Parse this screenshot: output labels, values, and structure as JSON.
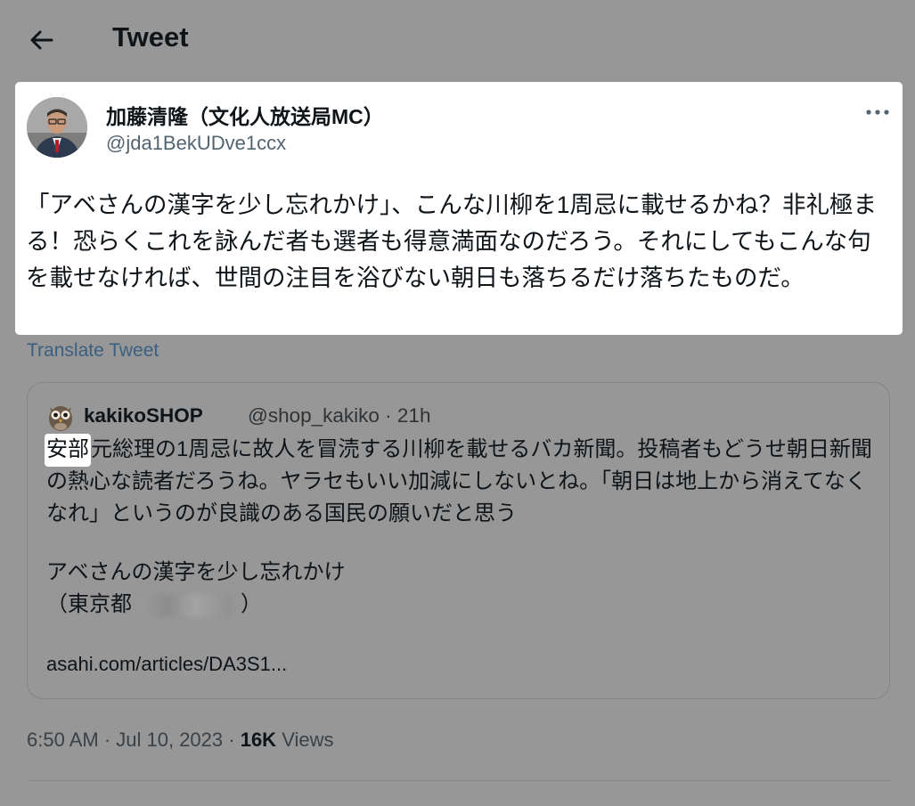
{
  "header": {
    "title": "Tweet",
    "back_icon": "arrow-left-icon"
  },
  "tweet": {
    "author_name": "加藤清隆（文化人放送局MC）",
    "author_handle": "@jda1BekUDve1ccx",
    "more_icon": "more-horizontal-icon",
    "text": "「アベさんの漢字を少し忘れかけ」、こんな川柳を1周忌に載せるかね？非礼極まる！恐らくこれを詠んだ者も選者も得意満面なのだろう。それにしてもこんな句を載せなければ、世間の注目を浴びない朝日も落ちるだけ落ちたものだ。",
    "translate_label": "Translate Tweet"
  },
  "quote": {
    "avatar_icon": "owl-icon",
    "name": "kakikoSHOP",
    "meta": "@shop_kakiko · 21h",
    "highlighted_word": "安部",
    "text_rest": "元総理の1周忌に故人を冒涜する川柳を載せるバカ新聞。投稿者もどうせ朝日新聞の熱心な読者だろうね。ヤラセもいい加減にしないとね。「朝日は地上から消えてなくなれ」というのが良識のある国民の願いだと思う",
    "senryu_line": "アベさんの漢字を少し忘れかけ",
    "location_open": "（東京都",
    "location_close": "）",
    "link": "asahi.com/articles/DA3S1..."
  },
  "footer": {
    "time_date": "6:50 AM · Jul 10, 2023 · ",
    "views_count": "16K",
    "views_label": "Views"
  },
  "colors": {
    "overlay_bg": "#979797",
    "card_bg": "#ffffff",
    "link": "#3b5f80"
  }
}
